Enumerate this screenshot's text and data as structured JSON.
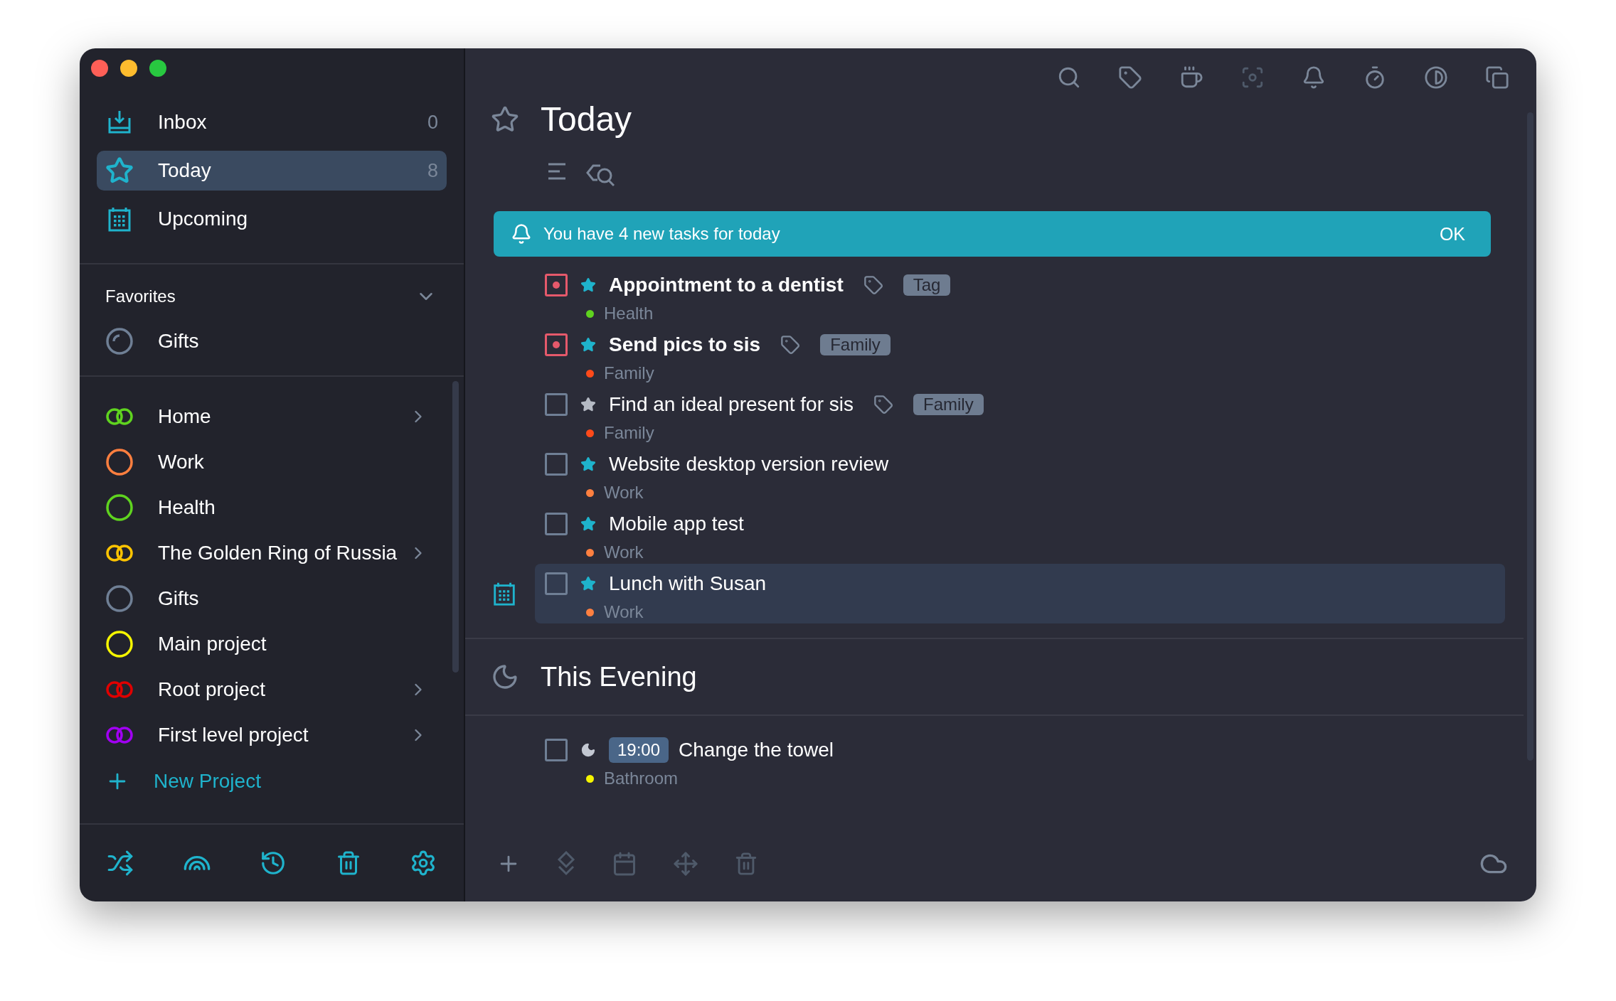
{
  "sidebar": {
    "nav": [
      {
        "kind": "inbox",
        "label": "Inbox",
        "count": "0",
        "selected": false
      },
      {
        "kind": "today",
        "label": "Today",
        "count": "8",
        "selected": true
      },
      {
        "kind": "upcoming",
        "label": "Upcoming",
        "selected": false
      }
    ],
    "favorites": {
      "title": "Favorites",
      "expanded": true,
      "items": [
        {
          "label": "Gifts",
          "color": "#6f7f95"
        }
      ]
    },
    "projects": [
      {
        "label": "Home",
        "color": "#5fd31f",
        "shared": true,
        "has_children": true
      },
      {
        "label": "Work",
        "color": "#ff7f3f",
        "shared": false,
        "has_children": false
      },
      {
        "label": "Health",
        "color": "#5fd31f",
        "shared": false,
        "has_children": false
      },
      {
        "label": "The Golden Ring of Russia",
        "color": "#ffc400",
        "shared": true,
        "has_children": true
      },
      {
        "label": "Gifts",
        "color": "#6f7f95",
        "shared": false,
        "has_children": false
      },
      {
        "label": "Main project",
        "color": "#f5f500",
        "shared": false,
        "has_children": false
      },
      {
        "label": "Root project",
        "color": "#e00000",
        "shared": true,
        "has_children": true
      },
      {
        "label": "First level project",
        "color": "#a100f2",
        "shared": true,
        "has_children": true
      }
    ],
    "new_project": "New Project"
  },
  "main": {
    "title": "Today",
    "notice": {
      "text": "You have 4 new tasks for today",
      "action": "OK"
    },
    "tasks": [
      {
        "title": "Appointment to a dentist",
        "priority": true,
        "starred": true,
        "tag": "Tag",
        "project": "Health",
        "color": "#5fd31f",
        "selected": false
      },
      {
        "title": "Send pics to sis",
        "priority": true,
        "starred": true,
        "tag": "Family",
        "project": "Family",
        "color": "#ff4a1a",
        "selected": false
      },
      {
        "title": "Find an ideal present for sis",
        "priority": false,
        "starred": false,
        "tag": "Family",
        "project": "Family",
        "color": "#ff4a1a",
        "selected": false
      },
      {
        "title": "Website desktop version review",
        "priority": false,
        "starred": true,
        "project": "Work",
        "color": "#ff8040",
        "selected": false
      },
      {
        "title": "Mobile app test",
        "priority": false,
        "starred": true,
        "project": "Work",
        "color": "#ff8040",
        "selected": false
      },
      {
        "title": "Lunch with Susan",
        "priority": false,
        "starred": true,
        "project": "Work",
        "color": "#ff8040",
        "selected": true
      }
    ],
    "sections": [
      {
        "title": "This Evening",
        "tasks": [
          {
            "title": "Change the towel",
            "priority": false,
            "time": "19:00",
            "project": "Bathroom",
            "color": "#f5f500",
            "selected": false
          }
        ]
      }
    ],
    "footer": [
      {
        "kind": "add",
        "disabled": false
      },
      {
        "kind": "priority",
        "disabled": true
      },
      {
        "kind": "schedule",
        "disabled": true
      },
      {
        "kind": "move",
        "disabled": true
      },
      {
        "kind": "delete",
        "disabled": true
      }
    ]
  }
}
